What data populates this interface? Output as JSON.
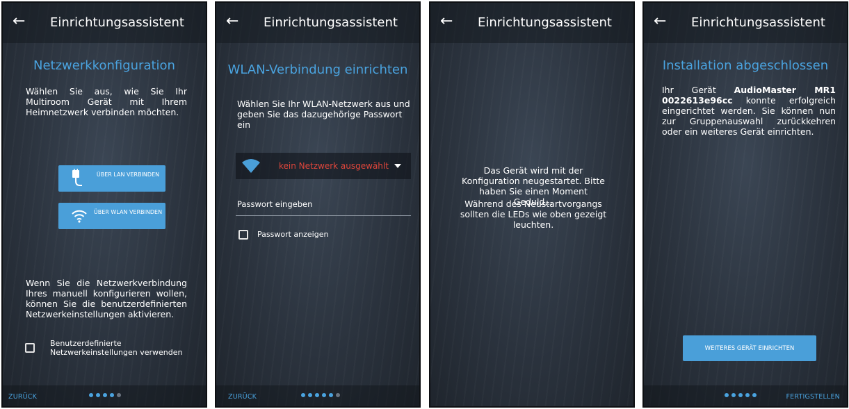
{
  "app": {
    "title": "Einrichtungsassistent",
    "back_icon": "arrow-left-icon"
  },
  "colors": {
    "accent": "#4aa3df",
    "button": "#4a9fd9",
    "error": "#e0463b",
    "background": "#2b333e"
  },
  "panel1": {
    "title": "Netzwerkkonfiguration",
    "intro": "Wählen Sie aus, wie Sie Ihr Multiroom Gerät mit Ihrem Heimnetzwerk verbinden möchten.",
    "lan_button": "ÜBER LAN VERBINDEN",
    "wlan_button": "ÜBER WLAN VERBINDEN",
    "manual_text": "Wenn Sie die Netzwerkverbindung Ihres manuell konfigurieren wollen, können Sie die benutzerdefinierten Netzwerkeinstellungen aktivieren.",
    "checkbox_label": "Benutzerdefinierte Netzwerkeinstellungen verwenden",
    "checkbox_checked": false,
    "back_label": "ZURÜCK",
    "step": 4,
    "steps_total": 5
  },
  "panel2": {
    "title": "WLAN-Verbindung einrichten",
    "intro": "Wählen Sie Ihr WLAN-Netzwerk aus und geben Sie das dazugehörige Passwort ein",
    "network_selected": "kein Netzwerk ausgewählt",
    "password_placeholder": "Passwort eingeben",
    "show_password_label": "Passwort anzeigen",
    "show_password_checked": false,
    "back_label": "ZURÜCK",
    "step": 5,
    "steps_total": 6
  },
  "panel3": {
    "message1": "Das Gerät wird mit der Konfiguration neugestartet. Bitte haben Sie einen Moment Geduld...",
    "message2": "Während des Neustartvorgangs sollten die LEDs wie oben gezeigt leuchten."
  },
  "panel4": {
    "title": "Installation abgeschlossen",
    "text_prefix": "Ihr Gerät",
    "device_name": "AudioMaster MR1 0022613e96cc",
    "text_suffix": "konnte erfolgreich eingerichtet werden. Sie können nun zur Gruppenauswahl zurückkehren oder ein weiteres Gerät einrichten.",
    "button": "WEITERES GERÄT EINRICHTEN",
    "finish_label": "FERTIGSTELLEN",
    "step": 5,
    "steps_total": 5
  }
}
